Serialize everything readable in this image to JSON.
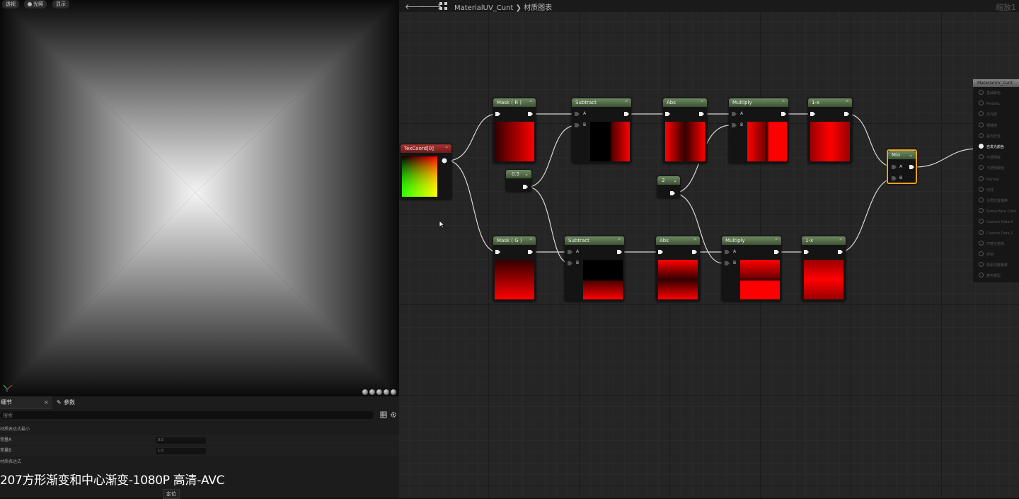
{
  "viewport": {
    "buttons": [
      {
        "label": "透视"
      },
      {
        "label": "光照"
      },
      {
        "label": "显示"
      }
    ]
  },
  "details": {
    "tabs": [
      {
        "label": "细节"
      },
      {
        "label": "参数"
      }
    ],
    "close_label": "×",
    "search_placeholder": "搜索",
    "sections": [
      {
        "label": "材质表达式最小"
      },
      {
        "label": "材质表达式"
      }
    ],
    "properties": [
      {
        "label": "常量A",
        "value": "0.0"
      },
      {
        "label": "常量B",
        "value": "1.0"
      }
    ]
  },
  "overlay": {
    "caption": "207方形渐变和中心渐变-1080P 高清-AVC",
    "tooltip": "定位"
  },
  "graph": {
    "breadcrumb": "MaterialUV_Cunt ❯ 材质图表",
    "zoom": "缩放1",
    "nodes": {
      "texcoord": "TexCoord[0]",
      "mask_r": "Mask ( R )",
      "mask_g": "Mask ( G )",
      "sub1": "Subtract",
      "sub2": "Subtract",
      "abs1": "Abs",
      "abs2": "Abs",
      "mul1": "Multiply",
      "mul2": "Multiply",
      "omx1": "1-x",
      "omx2": "1-x",
      "min": "Min",
      "const_half": "0.5",
      "const_two": "2"
    },
    "pin_a": "A",
    "pin_b": "B",
    "result": {
      "title": "MaterialUV_Cunt",
      "inputs": [
        "基础颜色",
        "Metallic",
        "高光度",
        "粗糙度",
        "各向异性",
        "自发光颜色",
        "不透明度",
        "不透明蒙版",
        "Normal",
        "切线",
        "全局位置偏移",
        "Subsurface Color",
        "Custom Data 0",
        "Custom Data 1",
        "环境光遮挡",
        "折射",
        "像素深度偏移",
        "着色模型"
      ],
      "active_index": 5
    }
  }
}
